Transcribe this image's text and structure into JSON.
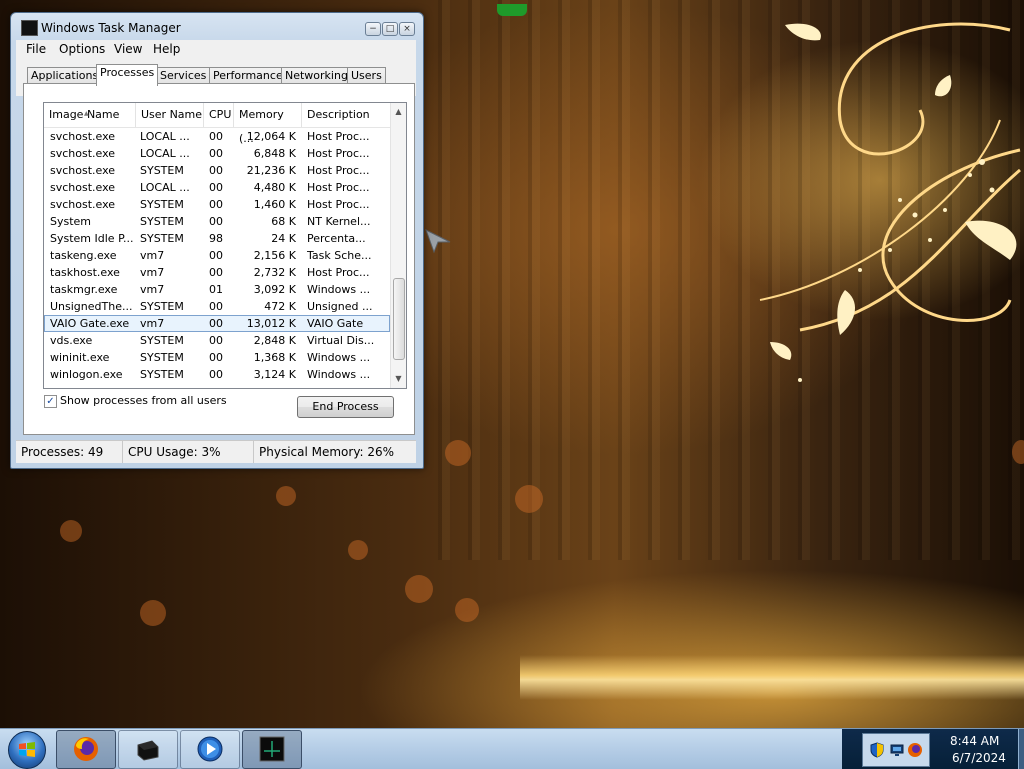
{
  "window": {
    "title": "Windows Task Manager",
    "controls": {
      "minimize": "−",
      "maximize": "□",
      "close": "×"
    }
  },
  "menu": [
    "File",
    "Options",
    "View",
    "Help"
  ],
  "tabs": [
    "Applications",
    "Processes",
    "Services",
    "Performance",
    "Networking",
    "Users"
  ],
  "active_tab": "Processes",
  "columns": [
    "Image Name",
    "User Name",
    "CPU",
    "Memory (...",
    "Description"
  ],
  "processes": [
    {
      "name": "svchost.exe",
      "user": "LOCAL ...",
      "cpu": "00",
      "memory": "12,064 K",
      "description": "Host Proc..."
    },
    {
      "name": "svchost.exe",
      "user": "LOCAL ...",
      "cpu": "00",
      "memory": "6,848 K",
      "description": "Host Proc..."
    },
    {
      "name": "svchost.exe",
      "user": "SYSTEM",
      "cpu": "00",
      "memory": "21,236 K",
      "description": "Host Proc..."
    },
    {
      "name": "svchost.exe",
      "user": "LOCAL ...",
      "cpu": "00",
      "memory": "4,480 K",
      "description": "Host Proc..."
    },
    {
      "name": "svchost.exe",
      "user": "SYSTEM",
      "cpu": "00",
      "memory": "1,460 K",
      "description": "Host Proc..."
    },
    {
      "name": "System",
      "user": "SYSTEM",
      "cpu": "00",
      "memory": "68 K",
      "description": "NT Kernel..."
    },
    {
      "name": "System Idle P...",
      "user": "SYSTEM",
      "cpu": "98",
      "memory": "24 K",
      "description": "Percenta..."
    },
    {
      "name": "taskeng.exe",
      "user": "vm7",
      "cpu": "00",
      "memory": "2,156 K",
      "description": "Task Sche..."
    },
    {
      "name": "taskhost.exe",
      "user": "vm7",
      "cpu": "00",
      "memory": "2,732 K",
      "description": "Host Proc..."
    },
    {
      "name": "taskmgr.exe",
      "user": "vm7",
      "cpu": "01",
      "memory": "3,092 K",
      "description": "Windows ..."
    },
    {
      "name": "UnsignedThe...",
      "user": "SYSTEM",
      "cpu": "00",
      "memory": "472 K",
      "description": "Unsigned ..."
    },
    {
      "name": "VAIO Gate.exe",
      "user": "vm7",
      "cpu": "00",
      "memory": "13,012 K",
      "description": "VAIO Gate",
      "selected": true
    },
    {
      "name": "vds.exe",
      "user": "SYSTEM",
      "cpu": "00",
      "memory": "2,848 K",
      "description": "Virtual Dis..."
    },
    {
      "name": "wininit.exe",
      "user": "SYSTEM",
      "cpu": "00",
      "memory": "1,368 K",
      "description": "Windows ..."
    },
    {
      "name": "winlogon.exe",
      "user": "SYSTEM",
      "cpu": "00",
      "memory": "3,124 K",
      "description": "Windows ..."
    }
  ],
  "show_all_users": {
    "label": "Show processes from all users",
    "checked": true,
    "mark": "✓"
  },
  "end_process_label": "End Process",
  "status": {
    "processes": "Processes: 49",
    "cpu": "CPU Usage: 3%",
    "memory": "Physical Memory: 26%"
  },
  "taskbar": {
    "pinned": [
      {
        "icon": "firefox-icon",
        "active": true
      },
      {
        "icon": "black-box-icon",
        "active": false
      },
      {
        "icon": "media-player-icon",
        "active": false
      },
      {
        "icon": "task-manager-icon",
        "active": true
      }
    ],
    "tray_icons": [
      "shield-icon",
      "network-icon",
      "firefox-tray-icon"
    ],
    "time": "8:44 AM",
    "date": "6/7/2024"
  },
  "colors": {
    "selection": "#e8f3fd",
    "taskbar": "#b5cde6",
    "tray": "#062038",
    "wallpaper_gold": "#f5c15a"
  }
}
